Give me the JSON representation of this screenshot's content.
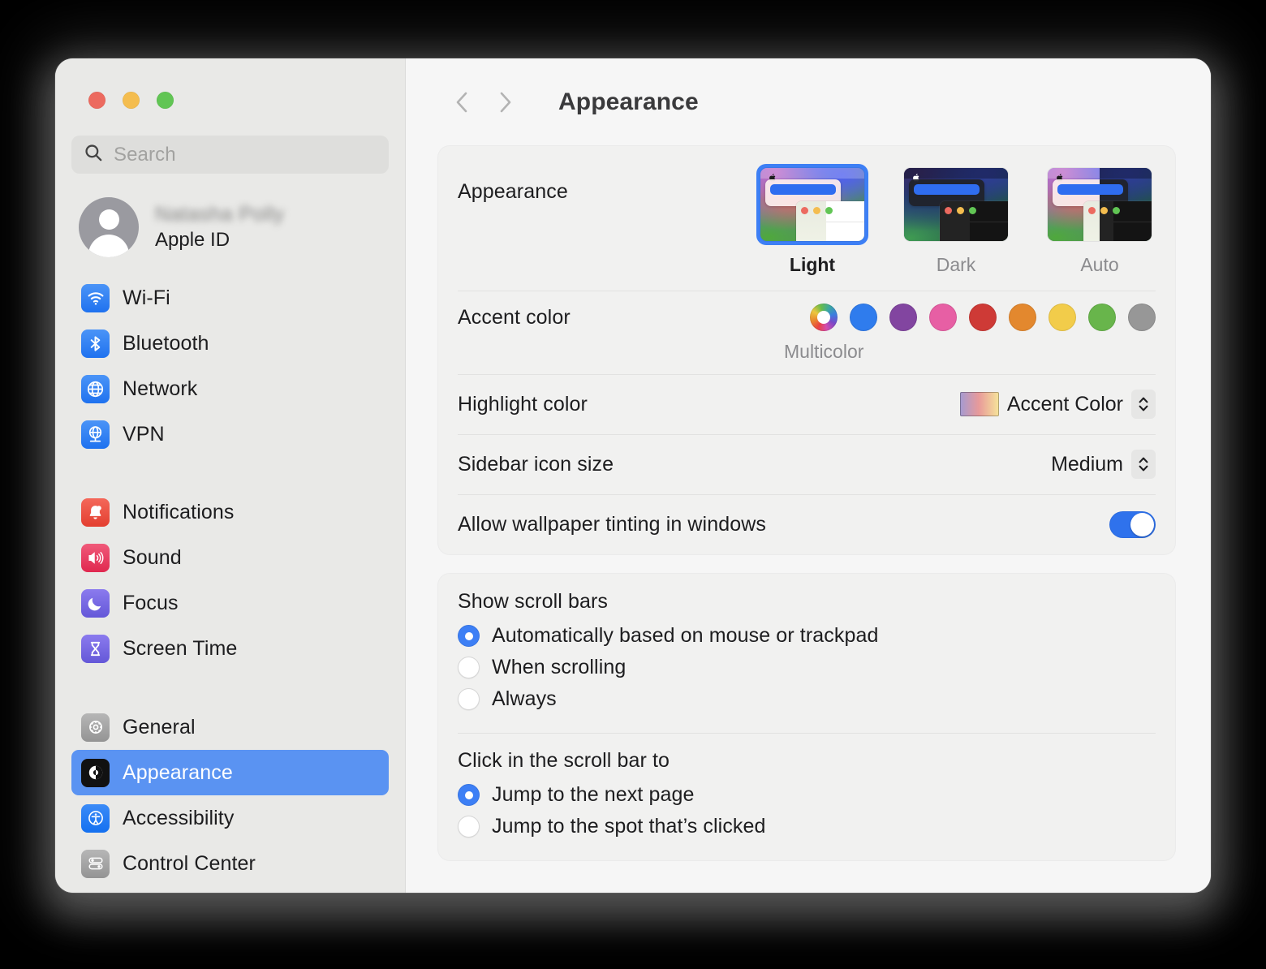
{
  "window": {
    "traffic_lights": [
      "close",
      "minimize",
      "zoom"
    ],
    "colors": {
      "accent": "#3d7ff5",
      "selected_row": "#5a93f2",
      "toggle_on": "#2f72ec"
    }
  },
  "sidebar": {
    "search": {
      "placeholder": "Search",
      "value": ""
    },
    "account": {
      "name": "Natasha Polly",
      "subtitle": "Apple ID"
    },
    "groups": [
      {
        "items": [
          {
            "label": "Wi-Fi",
            "icon": "wifi-icon"
          },
          {
            "label": "Bluetooth",
            "icon": "bluetooth-icon"
          },
          {
            "label": "Network",
            "icon": "network-globe-icon"
          },
          {
            "label": "VPN",
            "icon": "vpn-globe-icon"
          }
        ]
      },
      {
        "items": [
          {
            "label": "Notifications",
            "icon": "bell-icon"
          },
          {
            "label": "Sound",
            "icon": "speaker-icon"
          },
          {
            "label": "Focus",
            "icon": "moon-icon"
          },
          {
            "label": "Screen Time",
            "icon": "hourglass-icon"
          }
        ]
      },
      {
        "items": [
          {
            "label": "General",
            "icon": "gear-icon"
          },
          {
            "label": "Appearance",
            "icon": "appearance-contrast-icon",
            "selected": true
          },
          {
            "label": "Accessibility",
            "icon": "accessibility-icon"
          },
          {
            "label": "Control Center",
            "icon": "control-center-icon"
          }
        ]
      }
    ]
  },
  "header": {
    "title": "Appearance",
    "back": "back-chevron",
    "forward": "forward-chevron"
  },
  "main": {
    "appearance": {
      "label": "Appearance",
      "options": [
        {
          "label": "Light",
          "selected": true
        },
        {
          "label": "Dark",
          "selected": false
        },
        {
          "label": "Auto",
          "selected": false
        }
      ]
    },
    "accent_color": {
      "label": "Accent color",
      "caption": "Multicolor",
      "selected": "Multicolor",
      "swatches": [
        {
          "name": "Multicolor",
          "hex": "multicolor",
          "selected": true
        },
        {
          "name": "Blue",
          "hex": "#2f7ced"
        },
        {
          "name": "Purple",
          "hex": "#8245a0"
        },
        {
          "name": "Pink",
          "hex": "#e75fa4"
        },
        {
          "name": "Red",
          "hex": "#ce3a36"
        },
        {
          "name": "Orange",
          "hex": "#e3882e"
        },
        {
          "name": "Yellow",
          "hex": "#f2cc4a"
        },
        {
          "name": "Green",
          "hex": "#68b54b"
        },
        {
          "name": "Graphite",
          "hex": "#979797"
        }
      ]
    },
    "highlight_color": {
      "label": "Highlight color",
      "value": "Accent Color"
    },
    "sidebar_icon_size": {
      "label": "Sidebar icon size",
      "value": "Medium"
    },
    "wallpaper_tinting": {
      "label": "Allow wallpaper tinting in windows",
      "on": true
    },
    "show_scroll_bars": {
      "title": "Show scroll bars",
      "options": [
        {
          "label": "Automatically based on mouse or trackpad",
          "selected": true
        },
        {
          "label": "When scrolling",
          "selected": false
        },
        {
          "label": "Always",
          "selected": false
        }
      ]
    },
    "click_scroll_bar": {
      "title": "Click in the scroll bar to",
      "options": [
        {
          "label": "Jump to the next page",
          "selected": true
        },
        {
          "label": "Jump to the spot that’s clicked",
          "selected": false
        }
      ]
    }
  }
}
